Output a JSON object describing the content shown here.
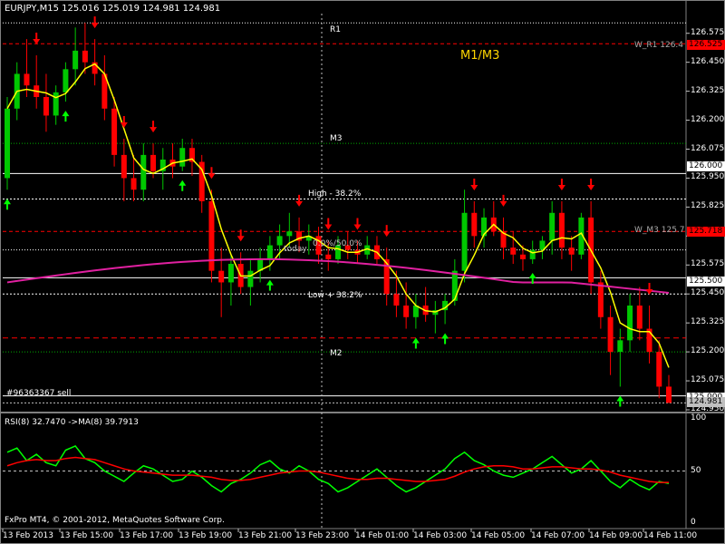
{
  "window": {
    "symbol_line": "EURJPY,M15  125.016 125.019 124.981 124.981",
    "strategy_label": "M1/M3",
    "order_label": "#96363367 sell",
    "footer": "FxPro MT4, © 2001-2012, MetaQuotes Software Corp.",
    "colors": {
      "background": "#000000",
      "bull_candle": "#00c800",
      "bear_candle": "#ff0000",
      "ma_line": "#ffff00",
      "pivot_line": "#e020a0",
      "rsi_line": "#00ff00",
      "rsi_ma_line": "#ff0000"
    }
  },
  "levels": {
    "r1": "R1",
    "m3": "M3",
    "high_382": "High - 38.2%",
    "low_382": "Low + 38.2%",
    "m2": "M2",
    "w_r1": "W_R1 126.4",
    "w_m3": "W_M3 125.7",
    "today_label": "today",
    "overlap_label": "0.0%/50.0%"
  },
  "price_axis": {
    "ticks": [
      "126.575",
      "126.450",
      "126.325",
      "126.200",
      "126.075",
      "125.950",
      "125.825",
      "125.700",
      "125.575",
      "125.450",
      "125.325",
      "125.200",
      "125.075",
      "124.950"
    ],
    "boxes": [
      {
        "label": "126.525",
        "color": "#ff0000",
        "text_color": "#000000"
      },
      {
        "label": "126.000",
        "color": "#ffffff",
        "text_color": "#000000"
      },
      {
        "label": "125.718",
        "color": "#ff0000",
        "text_color": "#000000"
      },
      {
        "label": "125.500",
        "color": "#ffffff",
        "text_color": "#000000"
      },
      {
        "label": "125.000",
        "color": "#ffffff",
        "text_color": "#000000"
      },
      {
        "label": "124.981",
        "color": "#c0c0c0",
        "text_color": "#000000"
      }
    ]
  },
  "rsi": {
    "title": "RSI(8) 32.7470  ->MA(8) 39.7913",
    "ticks": [
      "100",
      "50",
      "0"
    ]
  },
  "time_axis": [
    "13 Feb 2013",
    "13 Feb 15:00",
    "13 Feb 17:00",
    "13 Feb 19:00",
    "13 Feb 21:00",
    "13 Feb 23:00",
    "14 Feb 01:00",
    "14 Feb 03:00",
    "14 Feb 05:00",
    "14 Feb 07:00",
    "14 Feb 09:00",
    "14 Feb 11:00"
  ],
  "chart_data": {
    "type": "candlestick",
    "symbol": "EURJPY",
    "timeframe": "M15",
    "ylim": [
      124.95,
      126.66
    ],
    "candles": [
      {
        "o": 125.95,
        "h": 126.3,
        "l": 125.9,
        "c": 126.25
      },
      {
        "o": 126.25,
        "h": 126.45,
        "l": 126.2,
        "c": 126.4
      },
      {
        "o": 126.4,
        "h": 126.55,
        "l": 126.3,
        "c": 126.35
      },
      {
        "o": 126.35,
        "h": 126.48,
        "l": 126.25,
        "c": 126.3
      },
      {
        "o": 126.3,
        "h": 126.4,
        "l": 126.15,
        "c": 126.22
      },
      {
        "o": 126.22,
        "h": 126.35,
        "l": 126.18,
        "c": 126.32
      },
      {
        "o": 126.32,
        "h": 126.45,
        "l": 126.28,
        "c": 126.42
      },
      {
        "o": 126.42,
        "h": 126.6,
        "l": 126.35,
        "c": 126.5
      },
      {
        "o": 126.5,
        "h": 126.62,
        "l": 126.4,
        "c": 126.45
      },
      {
        "o": 126.45,
        "h": 126.55,
        "l": 126.35,
        "c": 126.4
      },
      {
        "o": 126.4,
        "h": 126.48,
        "l": 126.2,
        "c": 126.25
      },
      {
        "o": 126.25,
        "h": 126.3,
        "l": 126.0,
        "c": 126.05
      },
      {
        "o": 126.05,
        "h": 126.12,
        "l": 125.85,
        "c": 125.95
      },
      {
        "o": 125.95,
        "h": 126.05,
        "l": 125.85,
        "c": 125.9
      },
      {
        "o": 125.9,
        "h": 126.1,
        "l": 125.85,
        "c": 126.05
      },
      {
        "o": 126.05,
        "h": 126.1,
        "l": 125.95,
        "c": 125.98
      },
      {
        "o": 125.98,
        "h": 126.08,
        "l": 125.9,
        "c": 126.03
      },
      {
        "o": 126.03,
        "h": 126.1,
        "l": 125.95,
        "c": 126.0
      },
      {
        "o": 126.0,
        "h": 126.12,
        "l": 125.98,
        "c": 126.08
      },
      {
        "o": 126.08,
        "h": 126.12,
        "l": 125.96,
        "c": 126.02
      },
      {
        "o": 126.02,
        "h": 126.05,
        "l": 125.8,
        "c": 125.85
      },
      {
        "o": 125.85,
        "h": 125.9,
        "l": 125.5,
        "c": 125.55
      },
      {
        "o": 125.55,
        "h": 125.65,
        "l": 125.35,
        "c": 125.5
      },
      {
        "o": 125.5,
        "h": 125.62,
        "l": 125.4,
        "c": 125.58
      },
      {
        "o": 125.58,
        "h": 125.63,
        "l": 125.45,
        "c": 125.48
      },
      {
        "o": 125.48,
        "h": 125.6,
        "l": 125.4,
        "c": 125.55
      },
      {
        "o": 125.55,
        "h": 125.65,
        "l": 125.5,
        "c": 125.6
      },
      {
        "o": 125.6,
        "h": 125.7,
        "l": 125.55,
        "c": 125.66
      },
      {
        "o": 125.66,
        "h": 125.75,
        "l": 125.6,
        "c": 125.7
      },
      {
        "o": 125.7,
        "h": 125.8,
        "l": 125.65,
        "c": 125.72
      },
      {
        "o": 125.72,
        "h": 125.78,
        "l": 125.63,
        "c": 125.68
      },
      {
        "o": 125.68,
        "h": 125.75,
        "l": 125.62,
        "c": 125.7
      },
      {
        "o": 125.7,
        "h": 125.74,
        "l": 125.58,
        "c": 125.62
      },
      {
        "o": 125.62,
        "h": 125.68,
        "l": 125.55,
        "c": 125.6
      },
      {
        "o": 125.6,
        "h": 125.7,
        "l": 125.58,
        "c": 125.66
      },
      {
        "o": 125.66,
        "h": 125.72,
        "l": 125.6,
        "c": 125.64
      },
      {
        "o": 125.64,
        "h": 125.68,
        "l": 125.58,
        "c": 125.62
      },
      {
        "o": 125.62,
        "h": 125.7,
        "l": 125.6,
        "c": 125.66
      },
      {
        "o": 125.66,
        "h": 125.7,
        "l": 125.58,
        "c": 125.6
      },
      {
        "o": 125.6,
        "h": 125.65,
        "l": 125.4,
        "c": 125.45
      },
      {
        "o": 125.45,
        "h": 125.55,
        "l": 125.35,
        "c": 125.4
      },
      {
        "o": 125.4,
        "h": 125.5,
        "l": 125.3,
        "c": 125.35
      },
      {
        "o": 125.35,
        "h": 125.45,
        "l": 125.3,
        "c": 125.4
      },
      {
        "o": 125.4,
        "h": 125.48,
        "l": 125.33,
        "c": 125.36
      },
      {
        "o": 125.36,
        "h": 125.42,
        "l": 125.28,
        "c": 125.38
      },
      {
        "o": 125.38,
        "h": 125.45,
        "l": 125.32,
        "c": 125.42
      },
      {
        "o": 125.42,
        "h": 125.6,
        "l": 125.4,
        "c": 125.55
      },
      {
        "o": 125.55,
        "h": 125.9,
        "l": 125.5,
        "c": 125.8
      },
      {
        "o": 125.8,
        "h": 125.85,
        "l": 125.65,
        "c": 125.7
      },
      {
        "o": 125.7,
        "h": 125.82,
        "l": 125.65,
        "c": 125.78
      },
      {
        "o": 125.78,
        "h": 125.85,
        "l": 125.7,
        "c": 125.72
      },
      {
        "o": 125.72,
        "h": 125.78,
        "l": 125.6,
        "c": 125.65
      },
      {
        "o": 125.65,
        "h": 125.72,
        "l": 125.58,
        "c": 125.62
      },
      {
        "o": 125.62,
        "h": 125.66,
        "l": 125.55,
        "c": 125.6
      },
      {
        "o": 125.6,
        "h": 125.68,
        "l": 125.58,
        "c": 125.64
      },
      {
        "o": 125.64,
        "h": 125.7,
        "l": 125.6,
        "c": 125.68
      },
      {
        "o": 125.68,
        "h": 125.85,
        "l": 125.62,
        "c": 125.8
      },
      {
        "o": 125.8,
        "h": 125.85,
        "l": 125.6,
        "c": 125.65
      },
      {
        "o": 125.65,
        "h": 125.7,
        "l": 125.55,
        "c": 125.62
      },
      {
        "o": 125.62,
        "h": 125.8,
        "l": 125.6,
        "c": 125.78
      },
      {
        "o": 125.78,
        "h": 125.85,
        "l": 125.45,
        "c": 125.5
      },
      {
        "o": 125.5,
        "h": 125.55,
        "l": 125.3,
        "c": 125.35
      },
      {
        "o": 125.35,
        "h": 125.4,
        "l": 125.1,
        "c": 125.2
      },
      {
        "o": 125.2,
        "h": 125.3,
        "l": 125.05,
        "c": 125.25
      },
      {
        "o": 125.25,
        "h": 125.45,
        "l": 125.2,
        "c": 125.4
      },
      {
        "o": 125.4,
        "h": 125.48,
        "l": 125.25,
        "c": 125.3
      },
      {
        "o": 125.3,
        "h": 125.4,
        "l": 125.15,
        "c": 125.2
      },
      {
        "o": 125.2,
        "h": 125.25,
        "l": 125.0,
        "c": 125.05
      },
      {
        "o": 125.05,
        "h": 125.1,
        "l": 124.98,
        "c": 124.98
      }
    ],
    "rsi": [
      68,
      72,
      60,
      66,
      58,
      55,
      70,
      74,
      62,
      58,
      50,
      45,
      40,
      48,
      55,
      52,
      46,
      40,
      42,
      50,
      44,
      36,
      30,
      38,
      42,
      48,
      56,
      60,
      52,
      48,
      55,
      50,
      42,
      38,
      30,
      34,
      40,
      46,
      52,
      44,
      36,
      30,
      34,
      40,
      46,
      52,
      62,
      68,
      60,
      56,
      50,
      46,
      44,
      48,
      52,
      58,
      64,
      56,
      48,
      52,
      60,
      50,
      40,
      34,
      42,
      36,
      32,
      40,
      38,
      33
    ],
    "rsi_ma": [
      55,
      58,
      60,
      61,
      60,
      60,
      62,
      63,
      62,
      61,
      58,
      55,
      52,
      50,
      49,
      48,
      47,
      46,
      46,
      46,
      45,
      44,
      42,
      41,
      41,
      42,
      44,
      46,
      48,
      49,
      50,
      50,
      49,
      47,
      45,
      43,
      42,
      42,
      43,
      43,
      42,
      41,
      40,
      40,
      41,
      42,
      45,
      49,
      52,
      54,
      55,
      55,
      54,
      52,
      52,
      53,
      54,
      54,
      53,
      52,
      52,
      51,
      49,
      46,
      44,
      42,
      40,
      39,
      39,
      40
    ]
  }
}
